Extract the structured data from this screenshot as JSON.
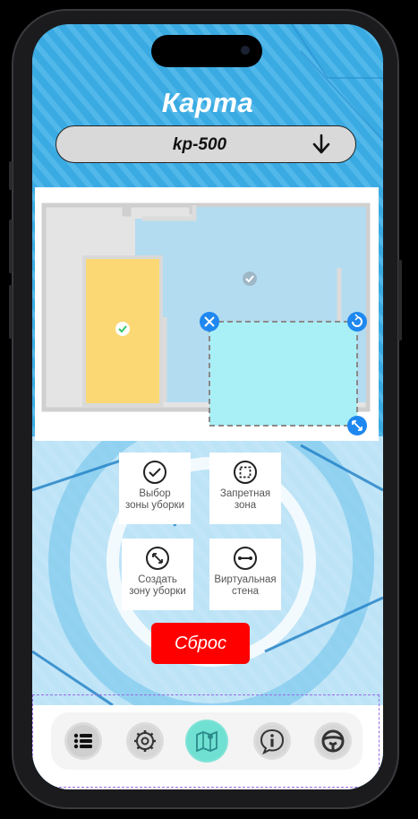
{
  "header": {
    "title": "Карта"
  },
  "device": {
    "name": "kp-500"
  },
  "tools": [
    {
      "label": "Выбор\nзоны уборки"
    },
    {
      "label": "Запретная\nзона"
    },
    {
      "label": "Создать\nзону уборки"
    },
    {
      "label": "Виртуальная\nстена"
    }
  ],
  "reset_label": "Сброс",
  "nav": {
    "items": [
      "list-icon",
      "gear-icon",
      "map-icon",
      "info-icon",
      "steering-wheel-icon"
    ],
    "active": "map-icon"
  },
  "colors": {
    "accent_red": "#ff0000",
    "room_yellow": "#fbd874",
    "room_blue": "#b3dcf0",
    "zone_cyan": "#a8f0f5",
    "marker_blue": "#1e88f0"
  }
}
